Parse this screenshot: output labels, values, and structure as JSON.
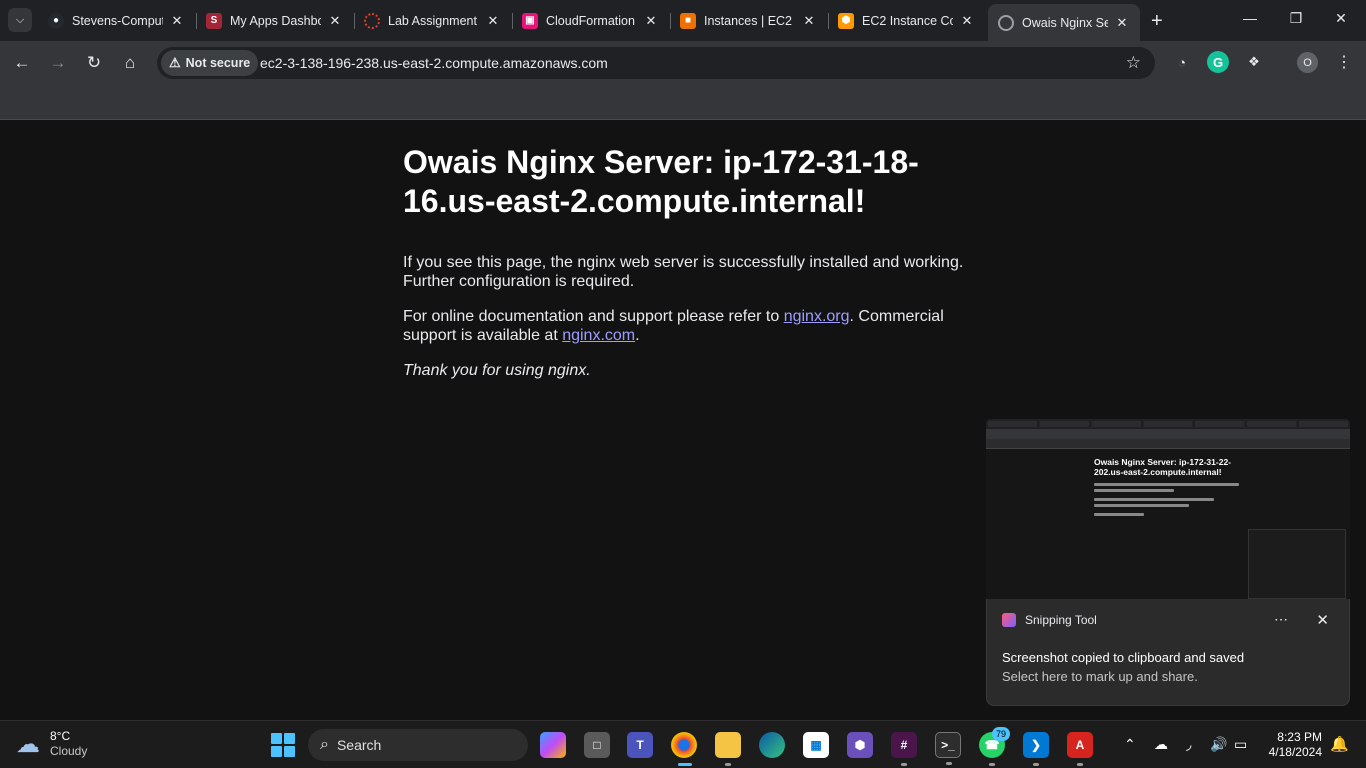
{
  "browser": {
    "tabs": [
      {
        "title": "Stevens-Comput",
        "icon": "github-icon",
        "color": "#ffffff"
      },
      {
        "title": "My Apps Dashbo",
        "icon": "stevens-icon",
        "color": "#a32638"
      },
      {
        "title": "Lab Assignment",
        "icon": "canvas-icon",
        "color": "#e13f2b"
      },
      {
        "title": "CloudFormation",
        "icon": "cloudformation-icon",
        "color": "#e7157b"
      },
      {
        "title": "Instances | EC2 |",
        "icon": "ec2-icon",
        "color": "#ed7100"
      },
      {
        "title": "EC2 Instance Co",
        "icon": "ec2-box-icon",
        "color": "#ff9900"
      },
      {
        "title": "Owais Nginx Ser",
        "icon": "globe-icon",
        "color": "#9aa0a6"
      }
    ],
    "security_label": "Not secure",
    "url": "ec2-3-138-196-238.us-east-2.compute.amazonaws.com",
    "profile_initial": "O"
  },
  "page": {
    "heading": "Owais Nginx Server: ip-172-31-18-16.us-east-2.compute.internal!",
    "para1": "If you see this page, the nginx web server is successfully installed and working. Further configuration is required.",
    "para2_prefix": "For online documentation and support please refer to ",
    "link1": "nginx.org",
    "para2_mid": ". Commercial support is available at ",
    "link2": "nginx.com",
    "para2_suffix": ".",
    "thanks": "Thank you for using nginx."
  },
  "snip_preview": {
    "heading": "Owais Nginx Server: ip-172-31-22-202.us-east-2.compute.internal!"
  },
  "toast": {
    "app": "Snipping Tool",
    "title": "Screenshot copied to clipboard and saved",
    "body": "Select here to mark up and share."
  },
  "taskbar": {
    "weather_temp": "8°C",
    "weather_cond": "Cloudy",
    "search_placeholder": "Search",
    "whatsapp_badge": "79",
    "time": "8:23 PM",
    "date": "4/18/2024"
  }
}
